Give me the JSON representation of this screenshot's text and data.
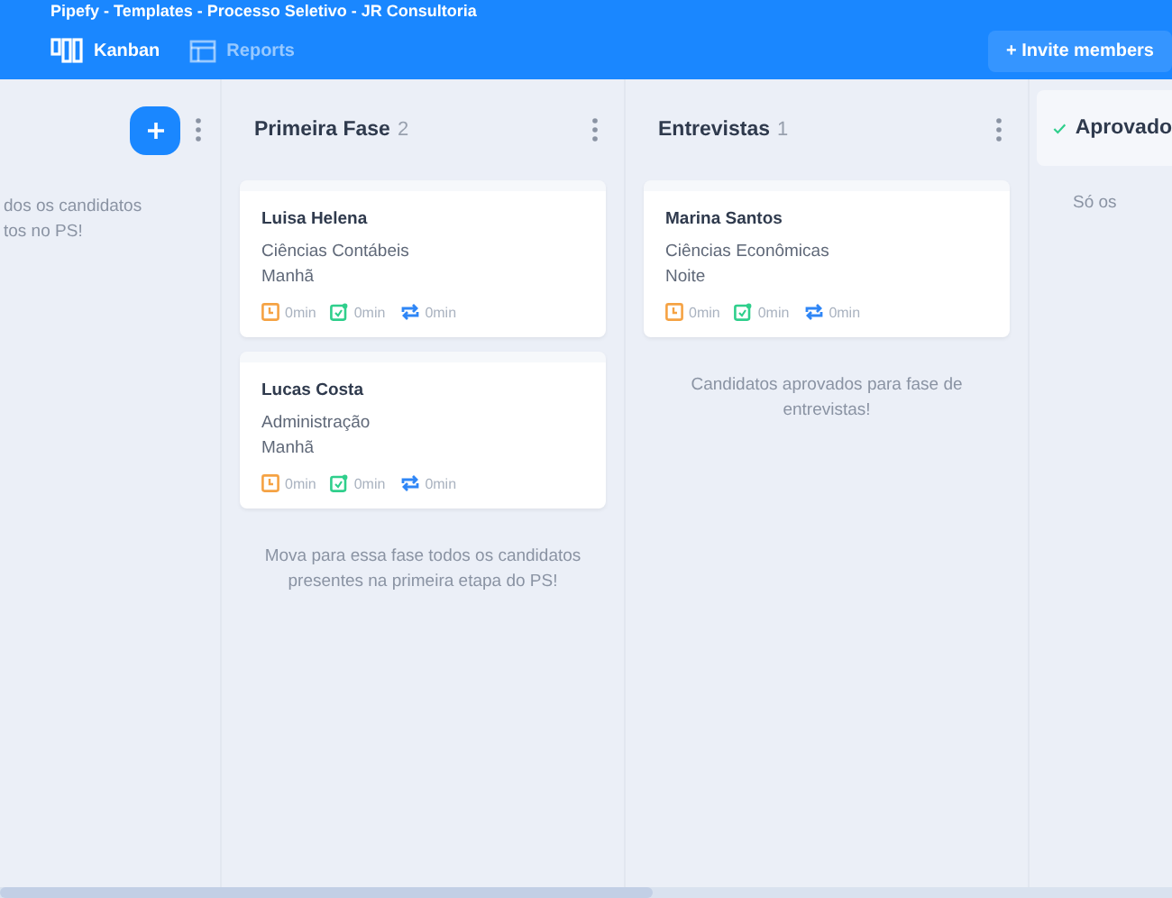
{
  "window": {
    "title": "Pipefy - Templates - Processo Seletivo - JR Consultoria"
  },
  "tabs": [
    {
      "label": "Kanban",
      "selected": true
    },
    {
      "label": "Reports",
      "selected": false
    }
  ],
  "invite_button": "+ Invite members",
  "columns": [
    {
      "kind": "partial-left",
      "note": "dos os candidatos\ntos no PS!"
    },
    {
      "kind": "phase",
      "title": "Primeira Fase",
      "count": "2",
      "note": "Mova para essa fase todos os candidatos presentes na primeira etapa do PS!",
      "cards": [
        {
          "name": "Luisa Helena",
          "course": "Ciências Contábeis",
          "shift": "Manhã",
          "times": [
            "0min",
            "0min",
            "0min"
          ]
        },
        {
          "name": "Lucas Costa",
          "course": "Administração",
          "shift": "Manhã",
          "times": [
            "0min",
            "0min",
            "0min"
          ]
        }
      ]
    },
    {
      "kind": "phase",
      "title": "Entrevistas",
      "count": "1",
      "note": "Candidatos aprovados para fase de entrevistas!",
      "cards": [
        {
          "name": "Marina Santos",
          "course": "Ciências Econômicas",
          "shift": "Noite",
          "times": [
            "0min",
            "0min",
            "0min"
          ]
        }
      ]
    },
    {
      "kind": "done",
      "title": "Aprovado",
      "note": "Só os"
    }
  ]
}
